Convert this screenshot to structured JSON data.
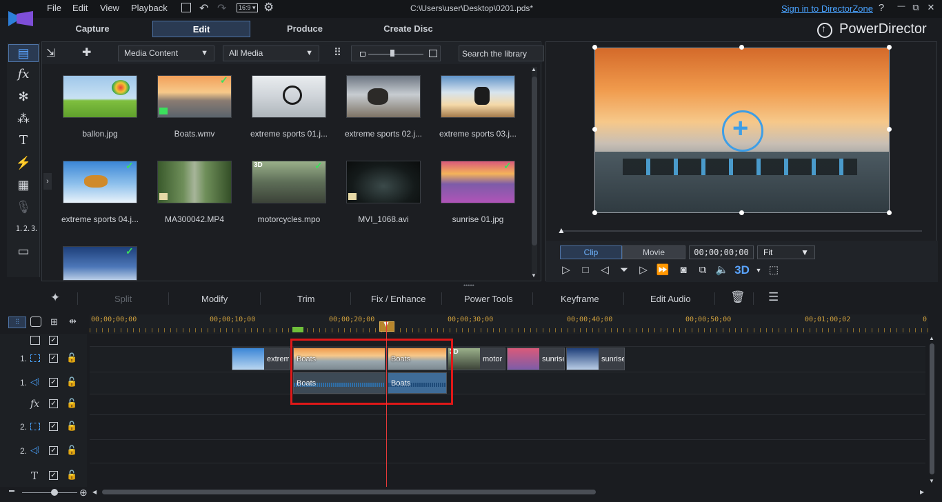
{
  "menu": [
    "File",
    "Edit",
    "View",
    "Playback"
  ],
  "title": "C:\\Users\\user\\Desktop\\0201.pds*",
  "sign_in": "Sign in to DirectorZone",
  "window_buttons": {
    "help": "?",
    "minimize": "—",
    "restore": "⧉",
    "close": "✕"
  },
  "modes": {
    "capture": "Capture",
    "edit": "Edit",
    "produce": "Produce",
    "create_disc": "Create Disc"
  },
  "brand": "PowerDirector",
  "library": {
    "content_dropdown": "Media Content",
    "filter_dropdown": "All Media",
    "search_placeholder": "Search the library",
    "items": [
      {
        "name": "ballon.jpg",
        "checked": false
      },
      {
        "name": "Boats.wmv",
        "checked": true
      },
      {
        "name": "extreme sports 01.j...",
        "checked": false
      },
      {
        "name": "extreme sports 02.j...",
        "checked": false
      },
      {
        "name": "extreme sports 03.j...",
        "checked": false
      },
      {
        "name": "extreme sports 04.j...",
        "checked": true
      },
      {
        "name": "MA300042.MP4",
        "checked": false
      },
      {
        "name": "motorcycles.mpo",
        "checked": true,
        "badge": "3D"
      },
      {
        "name": "MVI_1068.avi",
        "checked": false
      },
      {
        "name": "sunrise 01.jpg",
        "checked": true
      },
      {
        "name": "",
        "checked": true
      }
    ]
  },
  "preview": {
    "clip_label": "Clip",
    "movie_label": "Movie",
    "timecode": "00;00;00;00",
    "fit_label": "Fit",
    "threed": "3D"
  },
  "edit_tools": {
    "split": "Split",
    "modify": "Modify",
    "trim": "Trim",
    "fix_enhance": "Fix / Enhance",
    "power_tools": "Power Tools",
    "keyframe": "Keyframe",
    "edit_audio": "Edit Audio"
  },
  "ruler_labels": [
    "00;00;00;00",
    "00;00;10;00",
    "00;00;20;00",
    "00;00;30;00",
    "00;00;40;00",
    "00;00;50;00",
    "00;01;00;02",
    "0"
  ],
  "tracks": {
    "video1": "1.",
    "audio1": "1.",
    "fx": "fx",
    "video2": "2.",
    "audio2": "2.",
    "title": "T"
  },
  "clips": {
    "extreme": "extrem",
    "boats1": "Boats",
    "boats2": "Boats",
    "motor": "motor",
    "sunrise1": "sunrise",
    "sunrise2": "sunrise",
    "audio_boats1": "Boats",
    "audio_boats2": "Boats",
    "motor_badge": "3D"
  },
  "colors": {
    "accent": "#4f75a8",
    "playhead": "#e53939",
    "highlight": "#e01818",
    "ruler_text": "#d2a23d"
  }
}
